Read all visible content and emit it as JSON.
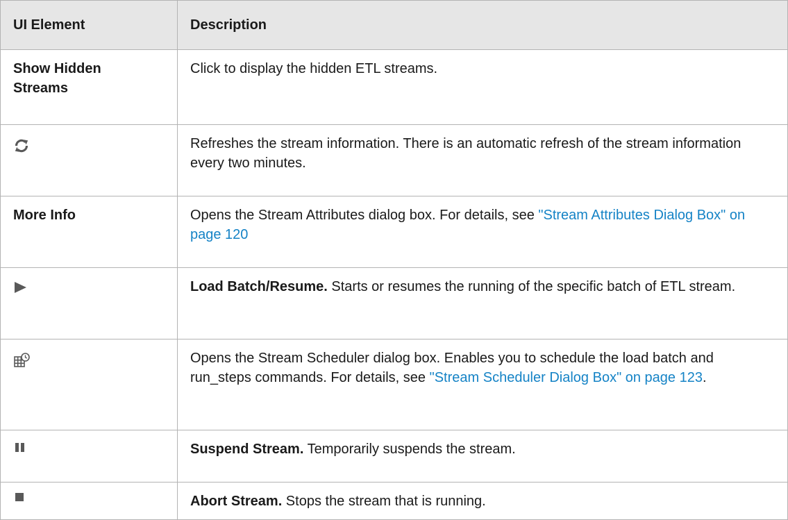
{
  "header": {
    "col1": "UI Element",
    "col2": "Description"
  },
  "rows": [
    {
      "element": "Show Hidden Streams",
      "description": "Click to display the hidden ETL streams."
    },
    {
      "element_icon": "refresh-icon",
      "description": "Refreshes the stream information. There is an automatic refresh of the stream information every two minutes."
    },
    {
      "element": "More Info",
      "description_prefix": "Opens the Stream Attributes dialog box. For details, see ",
      "link": "\"Stream Attributes Dialog Box\" on page 120"
    },
    {
      "element_icon": "play-icon",
      "lead": "Load Batch/Resume.",
      "description": " Starts or resumes the running of the specific batch of ETL stream."
    },
    {
      "element_icon": "scheduler-icon",
      "description_prefix": "Opens the Stream Scheduler dialog box. Enables you to schedule the load batch and run_steps commands. For details, see ",
      "link": "\"Stream Scheduler Dialog Box\" on page 123",
      "description_suffix": "."
    },
    {
      "element_icon": "pause-icon",
      "lead": "Suspend Stream.",
      "description": " Temporarily suspends the stream."
    },
    {
      "element_icon": "stop-icon",
      "lead": "Abort Stream.",
      "description": " Stops the stream that is running."
    }
  ],
  "colors": {
    "header_bg": "#e6e6e6",
    "border": "#b3b3b3",
    "link": "#1583c6",
    "icon": "#595959"
  }
}
